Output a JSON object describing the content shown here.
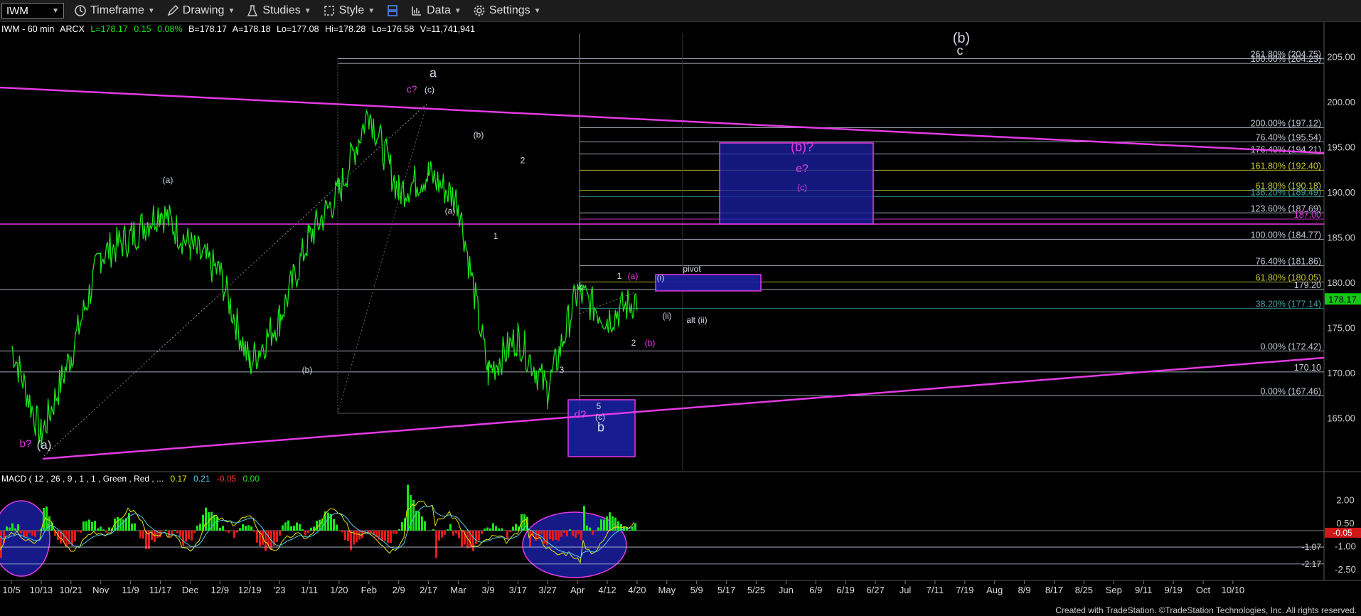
{
  "toolbar": {
    "symbol": "IWM",
    "timeframe": "Timeframe",
    "drawing": "Drawing",
    "studies": "Studies",
    "style": "Style",
    "data": "Data",
    "settings": "Settings"
  },
  "quote_line": {
    "symbol": "IWM - 60 min",
    "exchange": "ARCX",
    "last": "L=178.17",
    "change": "0.15",
    "change_pct": "0.08%",
    "bid": "B=178.17",
    "ask": "A=178.18",
    "low": "Lo=177.08",
    "high": "Hi=178.28",
    "low2": "Lo=176.58",
    "volume": "V=11,741,941"
  },
  "macd_line": {
    "label": "MACD ( 12 , 26 , 9 , 1 , 1 , Green , Red , ...",
    "v1": "0.17",
    "v2": "0.21",
    "v3": "-0.05",
    "v4": "0.00"
  },
  "colors": {
    "price": "#19e619",
    "magenta": "#e43ae4",
    "box": "#1a1fa0",
    "grid": "#333333",
    "label": "#cfd8e8",
    "last_tag": "#14c814",
    "neg_tag": "#d01818"
  },
  "footer": "Created with TradeStation. ©TradeStation Technologies, Inc. All rights reserved.",
  "chart_data": {
    "type": "line",
    "title": "",
    "xlabel": "",
    "ylabel": "",
    "ylim": [
      160.8,
      208.8
    ],
    "y_ticks": [
      165.0,
      170.0,
      175.0,
      180.0,
      185.0,
      190.0,
      195.0,
      200.0,
      205.0
    ],
    "last_price": "178.17",
    "x_ticks": [
      "10/5",
      "10/13",
      "10/21",
      "Nov",
      "11/9",
      "11/17",
      "Dec",
      "12/9",
      "12/19",
      "'23",
      "1/11",
      "1/20",
      "Feb",
      "2/9",
      "2/17",
      "Mar",
      "3/9",
      "3/17",
      "3/27",
      "Apr",
      "4/12",
      "4/20",
      "May",
      "5/9",
      "5/17",
      "5/25",
      "Jun",
      "6/9",
      "6/19",
      "6/27",
      "Jul",
      "7/11",
      "7/19",
      "Aug",
      "8/9",
      "8/17",
      "8/25",
      "Sep",
      "9/11",
      "9/19",
      "Oct",
      "10/10"
    ],
    "series": [
      {
        "x": [
          "10/5",
          "10/13",
          "10/21",
          "Nov",
          "11/9",
          "11/17",
          "Dec",
          "12/9",
          "12/19",
          "'23",
          "1/11",
          "1/20",
          "Feb",
          "2/9",
          "2/17",
          "Mar",
          "3/9",
          "3/17",
          "3/27",
          "Apr",
          "4/12",
          "4/20"
        ],
        "values": [
          173,
          163,
          172,
          183,
          185,
          188,
          184,
          181,
          171,
          176,
          185,
          190,
          199,
          190,
          192,
          189,
          170,
          174,
          168,
          179,
          176,
          178.17
        ]
      }
    ],
    "levels": [
      {
        "price": 204.75,
        "label": "261.80% (204.75)"
      },
      {
        "price": 204.23,
        "label": "100.00% (204.23)"
      },
      {
        "price": 197.12,
        "label": "200.00% (197.12)"
      },
      {
        "price": 195.54,
        "label": "76.40% (195.54)"
      },
      {
        "price": 194.21,
        "label": "176.40% (194.21)"
      },
      {
        "price": 192.4,
        "label": "161.80% (192.40)"
      },
      {
        "price": 190.18,
        "label": "61.80% (190.18)"
      },
      {
        "price": 189.49,
        "label": "138.20% (189.49)"
      },
      {
        "price": 187.69,
        "label": "123.60% (187.69)"
      },
      {
        "price": 187.0,
        "label": "187.00"
      },
      {
        "price": 184.77,
        "label": "100.00% (184.77)"
      },
      {
        "price": 181.86,
        "label": "76.40% (181.86)"
      },
      {
        "price": 180.05,
        "label": "61.80% (180.05)"
      },
      {
        "price": 179.2,
        "label": "179.20"
      },
      {
        "price": 177.14,
        "label": "38.20% (177.14)"
      },
      {
        "price": 172.42,
        "label": "0.00% (172.42)"
      },
      {
        "price": 170.1,
        "label": "170.10"
      },
      {
        "price": 167.46,
        "label": "0.00% (167.46)"
      }
    ],
    "wave_labels": [
      {
        "text": "(b)",
        "x": "Jul",
        "y": 206.5
      },
      {
        "text": "c",
        "x": "Jul",
        "y": 205.2
      },
      {
        "text": "a",
        "x": "Feb",
        "y": 202.7
      },
      {
        "text": "c?",
        "x": "1/20",
        "y": 201.0
      },
      {
        "text": "(c)",
        "x": "Feb",
        "y": 201.0
      },
      {
        "text": "(b)",
        "x": "2/17",
        "y": 196.0
      },
      {
        "text": "2",
        "x": "Mar",
        "y": 193.2
      },
      {
        "text": "(a)",
        "x": "11/9",
        "y": 191.0
      },
      {
        "text": "(a)",
        "x": "2/9",
        "y": 187.6
      },
      {
        "text": "1",
        "x": "2/17",
        "y": 184.8
      },
      {
        "text": "(b)?",
        "x": "5/17",
        "y": 194.5
      },
      {
        "text": "e?",
        "x": "5/17",
        "y": 192.2
      },
      {
        "text": "(c)",
        "x": "5/17",
        "y": 190.2
      },
      {
        "text": "pivot",
        "x": "4/12",
        "y": 181.2
      },
      {
        "text": "1",
        "x": "3/27",
        "y": 180.4
      },
      {
        "text": "(a)",
        "x": "Apr",
        "y": 180.4
      },
      {
        "text": "(i)",
        "x": "4/12",
        "y": 180.2
      },
      {
        "text": "4",
        "x": "3/17",
        "y": 179.1
      },
      {
        "text": "(ii)",
        "x": "4/12",
        "y": 176.0
      },
      {
        "text": "alt (ii)",
        "x": "4/20",
        "y": 175.5
      },
      {
        "text": "2",
        "x": "Apr",
        "y": 173.0
      },
      {
        "text": "(b)",
        "x": "Apr",
        "y": 173.0
      },
      {
        "text": "(b)",
        "x": "12/19",
        "y": 170.0
      },
      {
        "text": "3",
        "x": "3/9",
        "y": 170.0
      },
      {
        "text": "5",
        "x": "3/27",
        "y": 166.0
      },
      {
        "text": "(c)",
        "x": "3/27",
        "y": 164.8
      },
      {
        "text": "d?",
        "x": "3/17",
        "y": 165.0
      },
      {
        "text": "b",
        "x": "3/27",
        "y": 163.5
      },
      {
        "text": "b?",
        "x": "10/5",
        "y": 161.8
      },
      {
        "text": "(a)",
        "x": "10/13",
        "y": 161.6
      }
    ],
    "macd": {
      "ylim": [
        -3.1,
        3.0
      ],
      "y_ticks": [
        "2.00",
        "0.50",
        "-1.07",
        "-1.00",
        "-2.17",
        "-2.50"
      ],
      "tag": "-0.05"
    }
  }
}
